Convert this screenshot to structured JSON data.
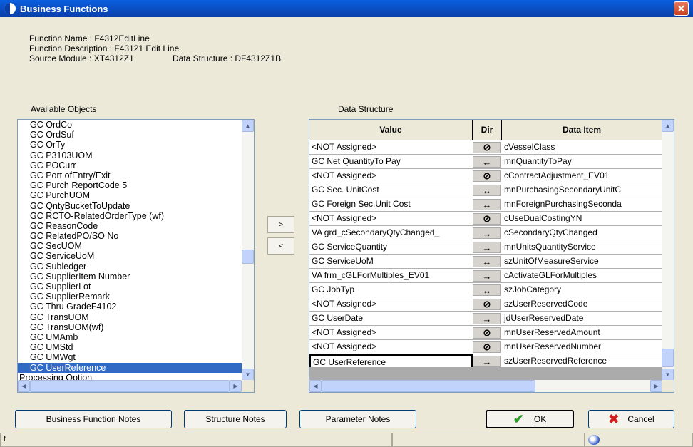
{
  "window": {
    "title": "Business Functions",
    "close": "✕"
  },
  "info": {
    "function_name": "Function Name : F4312EditLine",
    "function_description": "Function Description : F43121 Edit Line",
    "source_module": "Source Module : XT4312Z1",
    "data_structure": "Data Structure : DF4312Z1B"
  },
  "available_objects": {
    "label": "Available Objects",
    "items": [
      "GC OrdCo",
      "GC OrdSuf",
      "GC OrTy",
      "GC P3103UOM",
      "GC POCurr",
      "GC Port ofEntry/Exit",
      "GC Purch ReportCode 5",
      "GC PurchUOM",
      "GC QntyBucketToUpdate",
      "GC RCTO-RelatedOrderType (wf)",
      "GC ReasonCode",
      "GC RelatedPO/SO No",
      "GC SecUOM",
      "GC ServiceUoM",
      "GC Subledger",
      "GC SupplierItem Number",
      "GC SupplierLot",
      "GC SupplierRemark",
      "GC Thru GradeF4102",
      "GC TransUOM",
      "GC TransUOM(wf)",
      "GC UMAmb",
      "GC UMStd",
      "GC UMWgt",
      "GC UserReference"
    ],
    "selected_index": 24,
    "footer_item": "Processing Option"
  },
  "move_buttons": {
    "add": ">",
    "remove": "<"
  },
  "data_structure": {
    "label": "Data Structure",
    "columns": {
      "value": "Value",
      "dir": "Dir",
      "data_item": "Data Item"
    },
    "rows": [
      {
        "value": "<NOT Assigned>",
        "dir": "none",
        "dir_glyph": "⊘",
        "data_item": "cVesselClass"
      },
      {
        "value": "GC Net QuantityTo Pay",
        "dir": "in",
        "dir_glyph": "←",
        "data_item": "mnQuantityToPay"
      },
      {
        "value": "<NOT Assigned>",
        "dir": "none",
        "dir_glyph": "⊘",
        "data_item": "cContractAdjustment_EV01"
      },
      {
        "value": "GC Sec. UnitCost",
        "dir": "both",
        "dir_glyph": "↔",
        "data_item": "mnPurchasingSecondaryUnitC"
      },
      {
        "value": "GC Foreign Sec.Unit Cost",
        "dir": "both",
        "dir_glyph": "↔",
        "data_item": "mnForeignPurchasingSeconda"
      },
      {
        "value": "<NOT Assigned>",
        "dir": "none",
        "dir_glyph": "⊘",
        "data_item": "cUseDualCostingYN"
      },
      {
        "value": "VA grd_cSecondaryQtyChanged_",
        "dir": "out",
        "dir_glyph": "→",
        "data_item": "cSecondaryQtyChanged"
      },
      {
        "value": "GC ServiceQuantity",
        "dir": "out",
        "dir_glyph": "→",
        "data_item": "mnUnitsQuantityService"
      },
      {
        "value": "GC ServiceUoM",
        "dir": "both",
        "dir_glyph": "↔",
        "data_item": "szUnitOfMeasureService"
      },
      {
        "value": "VA frm_cGLForMultiples_EV01",
        "dir": "out",
        "dir_glyph": "→",
        "data_item": "cActivateGLForMultiples"
      },
      {
        "value": "GC JobTyp",
        "dir": "both",
        "dir_glyph": "↔",
        "data_item": "szJobCategory"
      },
      {
        "value": "<NOT Assigned>",
        "dir": "none",
        "dir_glyph": "⊘",
        "data_item": "szUserReservedCode"
      },
      {
        "value": "GC UserDate",
        "dir": "out",
        "dir_glyph": "→",
        "data_item": "jdUserReservedDate"
      },
      {
        "value": "<NOT Assigned>",
        "dir": "none",
        "dir_glyph": "⊘",
        "data_item": "mnUserReservedAmount"
      },
      {
        "value": "<NOT Assigned>",
        "dir": "none",
        "dir_glyph": "⊘",
        "data_item": "mnUserReservedNumber"
      },
      {
        "value": "GC UserReference",
        "dir": "out",
        "dir_glyph": "→",
        "data_item": "szUserReservedReference"
      }
    ]
  },
  "buttons": {
    "bf_notes": "Business Function Notes",
    "structure_notes": "Structure Notes",
    "parameter_notes": "Parameter Notes",
    "ok": "OK",
    "cancel": "Cancel"
  },
  "statusbar": {
    "left": "f"
  },
  "colors": {
    "title_bar": "#0a3fa8",
    "selection": "#316ac5",
    "ok_check": "#2a9a2a",
    "cancel_x": "#d02020"
  }
}
